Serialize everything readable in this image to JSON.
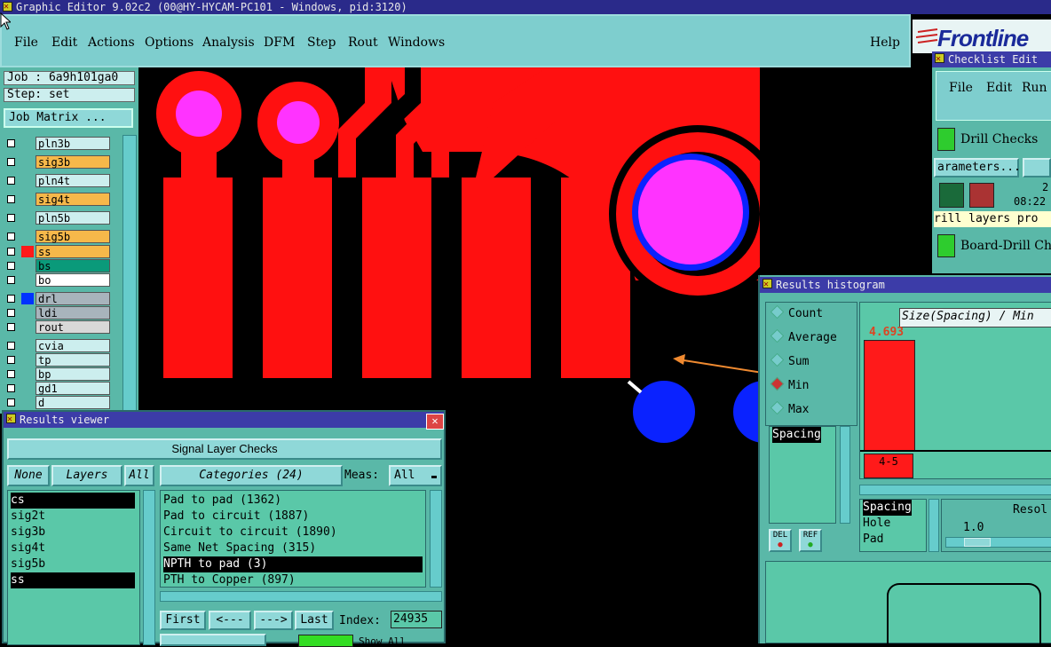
{
  "window_title": "Graphic Editor 9.02c2 (00@HY-HYCAM-PC101 - Windows, pid:3120)",
  "menu": [
    "File",
    "Edit",
    "Actions",
    "Options",
    "Analysis",
    "DFM",
    "Step",
    "Rout",
    "Windows"
  ],
  "menu_help": "Help",
  "brand": "Frontline",
  "job": "Job : 6a9h101ga0",
  "step": "Step: set",
  "job_matrix": "Job Matrix ...",
  "layers": [
    {
      "name": "pln3b",
      "color": "#cceeee",
      "swatch": ""
    },
    {
      "name": "sig3b",
      "color": "#f6b84a",
      "swatch": ""
    },
    {
      "name": "pln4t",
      "color": "#cceeee",
      "swatch": ""
    },
    {
      "name": "sig4t",
      "color": "#f6b84a",
      "swatch": ""
    },
    {
      "name": "pln5b",
      "color": "#cceeee",
      "swatch": ""
    },
    {
      "name": "sig5b",
      "color": "#f6b84a",
      "swatch": ""
    },
    {
      "name": "ss",
      "color": "#f6b84a",
      "swatch": "#ff1a1a"
    },
    {
      "name": "bs",
      "color": "#0a9a7a",
      "swatch": ""
    },
    {
      "name": "bo",
      "color": "#ffffff",
      "swatch": ""
    },
    {
      "name": "drl",
      "color": "#a8b4bc",
      "swatch": "#0033ff"
    },
    {
      "name": "ldi",
      "color": "#a8b4bc",
      "swatch": ""
    },
    {
      "name": "rout",
      "color": "#d8d8d8",
      "swatch": ""
    },
    {
      "name": "cvia",
      "color": "#cceeee",
      "swatch": ""
    },
    {
      "name": "tp",
      "color": "#cceeee",
      "swatch": ""
    },
    {
      "name": "bp",
      "color": "#cceeee",
      "swatch": ""
    },
    {
      "name": "gd1",
      "color": "#cceeee",
      "swatch": ""
    },
    {
      "name": "d",
      "color": "#cceeee",
      "swatch": ""
    }
  ],
  "results_viewer": {
    "title": "Results viewer",
    "header": "Signal Layer Checks",
    "none": "None",
    "layers_label": "Layers",
    "all": "All",
    "layer_list": [
      "cs",
      "sig2t",
      "sig3b",
      "sig4t",
      "sig5b",
      "ss"
    ],
    "categories": "Categories (24)",
    "meas_label": "Meas:",
    "meas_value": "All",
    "category_list": [
      "Pad to pad (1362)",
      "Pad to circuit (1887)",
      "Circuit to circuit (1890)",
      "Same Net Spacing (315)",
      "NPTH to pad (3)",
      "PTH to Copper (897)"
    ],
    "first": "First",
    "prev": "<---",
    "next": "--->",
    "last": "Last",
    "index_label": "Index:",
    "index_value": "24935",
    "show_all": "Show All"
  },
  "checklist": {
    "title": "Checklist Edit",
    "menu": [
      "File",
      "Edit",
      "Run"
    ],
    "drill_checks": "Drill Checks",
    "parameters": "arameters...",
    "time": "08:22",
    "date_frag": "2",
    "drill_text": "rill layers pro",
    "board_drill": "Board-Drill Che"
  },
  "histogram": {
    "title": "Results histogram",
    "options": [
      "Count",
      "Average",
      "Sum",
      "Min",
      "Max"
    ],
    "selected": "Min",
    "size_label": "Size(Spacing) / Min",
    "bar_value": "4.693",
    "bin_label": "4-5",
    "list1": [
      "Spacing"
    ],
    "list2": [
      "Spacing",
      "Hole",
      "Pad"
    ],
    "del": "DEL",
    "ref": "REF",
    "resol_label": "Resol",
    "resol_value": "1.0"
  }
}
